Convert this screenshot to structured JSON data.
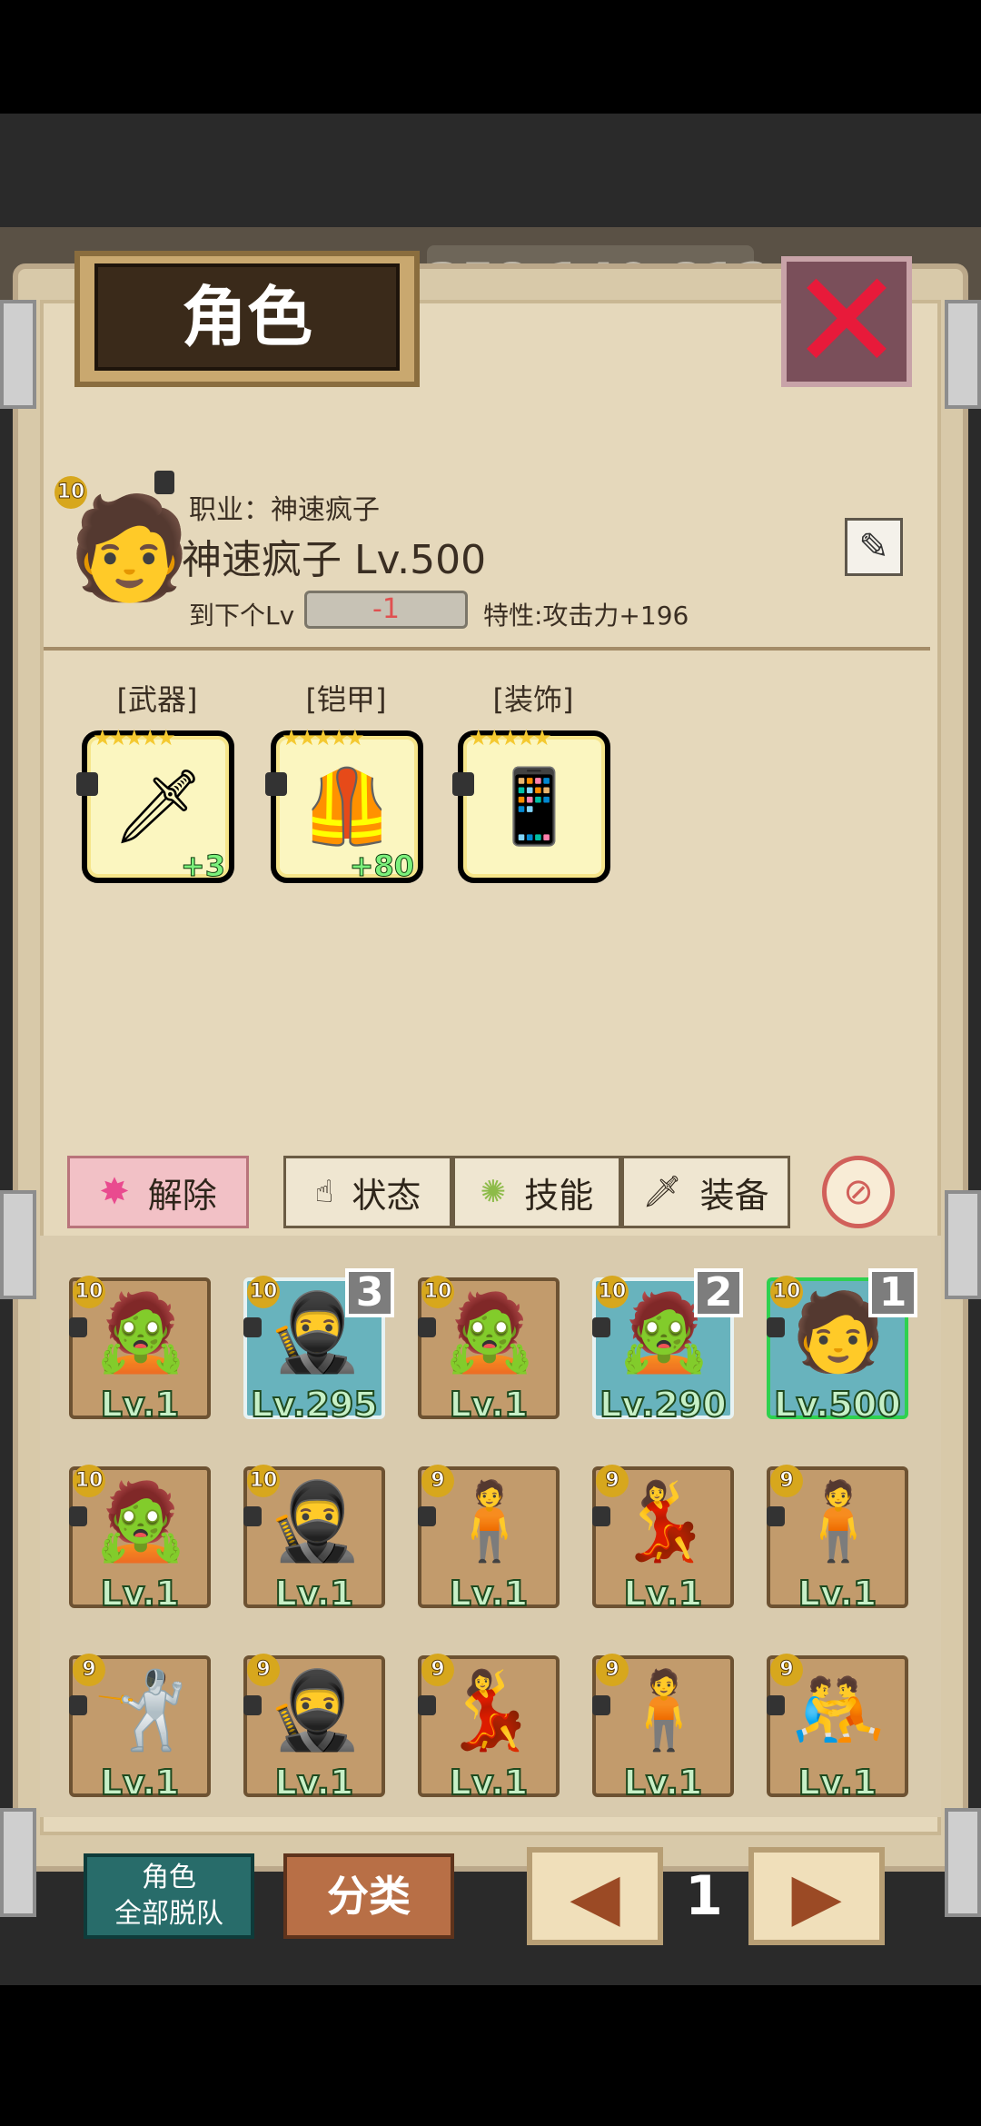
{
  "window": {
    "title": "角色",
    "close": "✕"
  },
  "background": {
    "gold": "358,140,812"
  },
  "character": {
    "job_prefix": "职业：",
    "job": "神速疯子",
    "name_level": "神速疯子 Lv.500",
    "badge": "10",
    "next_lv_label": "到下个Lv",
    "next_lv_value": "-1",
    "trait": "特性:攻击力+196"
  },
  "equipment": [
    {
      "label": "[武器]",
      "plus": "+3",
      "icon": "sword-icon"
    },
    {
      "label": "[铠甲]",
      "plus": "+80",
      "icon": "armor-icon"
    },
    {
      "label": "[装饰]",
      "plus": "",
      "icon": "accessory-icon"
    }
  ],
  "tabs": {
    "release": "解除",
    "status": "状态",
    "skills": "技能",
    "equip": "装备"
  },
  "roster": [
    {
      "badge": "10",
      "lv": "Lv.1",
      "rank": "",
      "style": "normal",
      "fig": "🧟"
    },
    {
      "badge": "10",
      "lv": "Lv.295",
      "rank": "3",
      "style": "teal",
      "fig": "🥷"
    },
    {
      "badge": "10",
      "lv": "Lv.1",
      "rank": "",
      "style": "normal",
      "fig": "🧟"
    },
    {
      "badge": "10",
      "lv": "Lv.290",
      "rank": "2",
      "style": "teal",
      "fig": "🧟"
    },
    {
      "badge": "10",
      "lv": "Lv.500",
      "rank": "1",
      "style": "green",
      "fig": "🧑"
    },
    {
      "badge": "10",
      "lv": "Lv.1",
      "rank": "",
      "style": "normal",
      "fig": "🧟"
    },
    {
      "badge": "10",
      "lv": "Lv.1",
      "rank": "",
      "style": "normal",
      "fig": "🥷"
    },
    {
      "badge": "9",
      "lv": "Lv.1",
      "rank": "",
      "style": "normal",
      "fig": "🧍"
    },
    {
      "badge": "9",
      "lv": "Lv.1",
      "rank": "",
      "style": "normal",
      "fig": "💃"
    },
    {
      "badge": "9",
      "lv": "Lv.1",
      "rank": "",
      "style": "normal",
      "fig": "🧍"
    },
    {
      "badge": "9",
      "lv": "Lv.1",
      "rank": "",
      "style": "normal",
      "fig": "🤺"
    },
    {
      "badge": "9",
      "lv": "Lv.1",
      "rank": "",
      "style": "normal",
      "fig": "🥷"
    },
    {
      "badge": "9",
      "lv": "Lv.1",
      "rank": "",
      "style": "normal",
      "fig": "💃"
    },
    {
      "badge": "9",
      "lv": "Lv.1",
      "rank": "",
      "style": "normal",
      "fig": "🧍"
    },
    {
      "badge": "9",
      "lv": "Lv.1",
      "rank": "",
      "style": "normal",
      "fig": "🤼"
    }
  ],
  "bottom": {
    "leave_line1": "角色",
    "leave_line2": "全部脱队",
    "category": "分类",
    "page": "1"
  }
}
